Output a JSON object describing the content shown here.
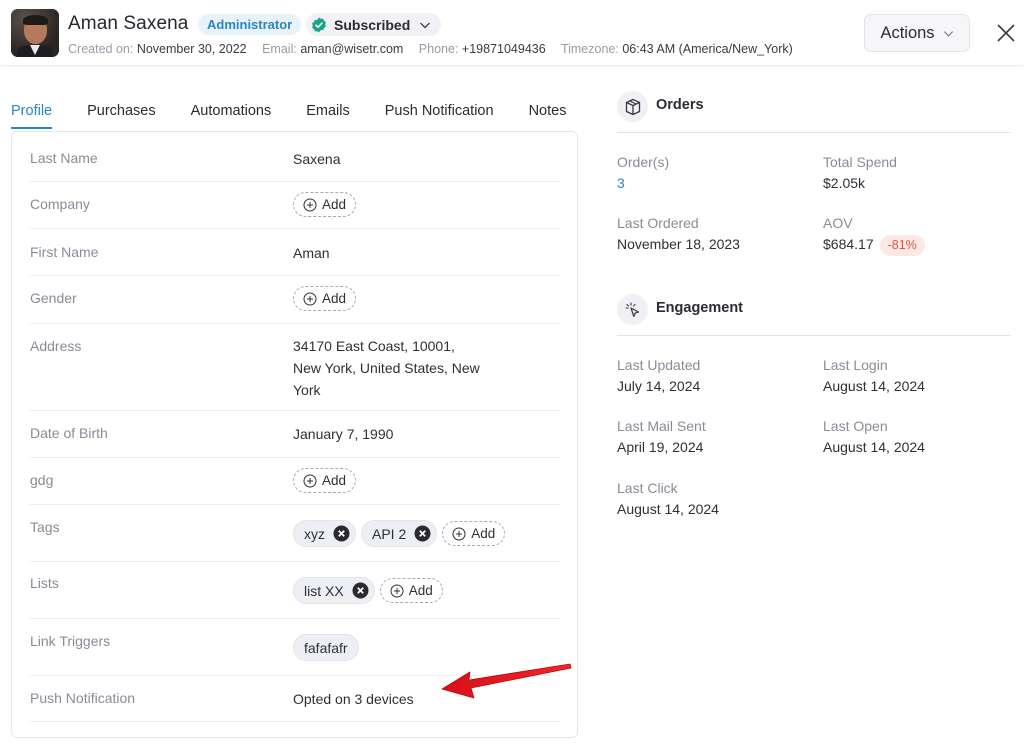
{
  "header": {
    "name": "Aman Saxena",
    "role_badge": "Administrator",
    "subscription_status": "Subscribed",
    "meta": [
      {
        "label": "Created on:",
        "value": "November 30, 2022"
      },
      {
        "label": "Email:",
        "value": "aman@wisetr.com"
      },
      {
        "label": "Phone:",
        "value": "+19871049436"
      },
      {
        "label": "Timezone:",
        "value": "06:43 AM (America/New_York)"
      }
    ],
    "actions_label": "Actions"
  },
  "tabs": [
    {
      "label": "Profile",
      "active": true
    },
    {
      "label": "Purchases",
      "active": false
    },
    {
      "label": "Automations",
      "active": false
    },
    {
      "label": "Emails",
      "active": false
    },
    {
      "label": "Push Notification",
      "active": false
    },
    {
      "label": "Notes",
      "active": false
    }
  ],
  "profile": {
    "add_label": "Add",
    "fields": {
      "last_name": {
        "label": "Last Name",
        "value": "Saxena"
      },
      "company": {
        "label": "Company"
      },
      "first_name": {
        "label": "First Name",
        "value": "Aman"
      },
      "gender": {
        "label": "Gender"
      },
      "address": {
        "label": "Address",
        "lines": [
          "34170 East Coast, 10001,",
          "New York, United States, New",
          "York"
        ]
      },
      "dob": {
        "label": "Date of Birth",
        "value": "January 7, 1990"
      },
      "gdg": {
        "label": "gdg"
      },
      "tags": {
        "label": "Tags",
        "items": [
          "xyz",
          "API 2"
        ]
      },
      "lists": {
        "label": "Lists",
        "items": [
          "list XX"
        ]
      },
      "link_triggers": {
        "label": "Link Triggers",
        "items": [
          "fafafafr"
        ]
      },
      "push_notification": {
        "label": "Push Notification",
        "value": "Opted on 3 devices"
      }
    }
  },
  "orders": {
    "title": "Orders",
    "orders_count": {
      "label": "Order(s)",
      "value": "3"
    },
    "total_spend": {
      "label": "Total Spend",
      "value": "$2.05k"
    },
    "last_ordered": {
      "label": "Last Ordered",
      "value": "November 18, 2023"
    },
    "aov": {
      "label": "AOV",
      "value": "$684.17",
      "change": "-81%"
    }
  },
  "engagement": {
    "title": "Engagement",
    "last_updated": {
      "label": "Last Updated",
      "value": "July 14, 2024"
    },
    "last_login": {
      "label": "Last Login",
      "value": "August 14, 2024"
    },
    "last_mail_sent": {
      "label": "Last Mail Sent",
      "value": "April 19, 2024"
    },
    "last_open": {
      "label": "Last Open",
      "value": "August 14, 2024"
    },
    "last_click": {
      "label": "Last Click",
      "value": "August 14, 2024"
    }
  },
  "colors": {
    "accent": "#2a86c5",
    "subscribed": "#1aa38a",
    "negative": "#e5533f",
    "annotation_arrow": "#e8131a"
  }
}
